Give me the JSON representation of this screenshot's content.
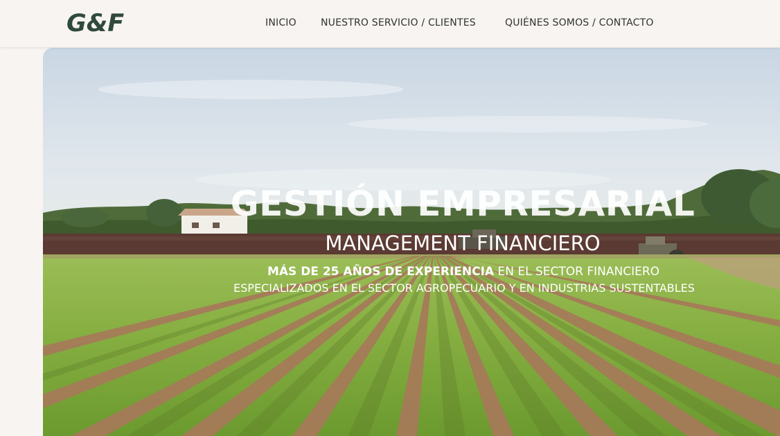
{
  "header": {
    "logo": "G&F",
    "nav": {
      "inicio": "INICIO",
      "servicio": "NUESTRO SERVICIO / CLIENTES",
      "quienes": "QUIÉNES SOMOS / CONTACTO"
    }
  },
  "hero": {
    "title": "GESTIÓN EMPRESARIAL",
    "subtitle": "MANAGEMENT FINANCIERO",
    "tagline_bold": "MÁS DE 25 AÑOS DE EXPERIENCIA",
    "tagline_rest": " EN EL SECTOR FINANCIERO",
    "tagline2": "ESPECIALIZADOS EN EL SECTOR AGROPECUARIO Y EN INDUSTRIAS SUSTENTABLES",
    "image_subject": "farm field with rows of lettuce and tractors"
  },
  "colors": {
    "page_background": "#f7f4f1",
    "logo": "#2f4a3c",
    "nav_text": "#2f3330",
    "hero_text": "#ffffff"
  }
}
